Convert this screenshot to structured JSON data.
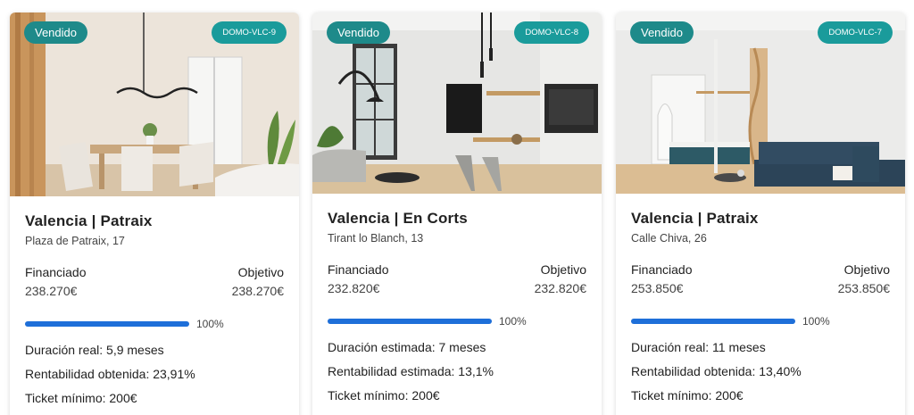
{
  "cards": [
    {
      "sold_label": "Vendido",
      "ref": "DOMO-VLC-9",
      "city": "Valencia | Patraix",
      "street": "Plaza de Patraix, 17",
      "financed_label": "Financiado",
      "financed_value": "238.270€",
      "target_label": "Objetivo",
      "target_value": "238.270€",
      "progress": 1.0,
      "progress_text": "100%",
      "duration": "Duración real: 5,9 meses",
      "returns": "Rentabilidad obtenida: 23,91%",
      "ticket": "Ticket mínimo: 200€"
    },
    {
      "sold_label": "Vendido",
      "ref": "DOMO-VLC-8",
      "city": "Valencia | En Corts",
      "street": "Tirant lo Blanch, 13",
      "financed_label": "Financiado",
      "financed_value": "232.820€",
      "target_label": "Objetivo",
      "target_value": "232.820€",
      "progress": 1.0,
      "progress_text": "100%",
      "duration": "Duración estimada: 7 meses",
      "returns": "Rentabilidad estimada: 13,1%",
      "ticket": "Ticket mínimo: 200€"
    },
    {
      "sold_label": "Vendido",
      "ref": "DOMO-VLC-7",
      "city": "Valencia | Patraix",
      "street": "Calle Chiva, 26",
      "financed_label": "Financiado",
      "financed_value": "253.850€",
      "target_label": "Objetivo",
      "target_value": "253.850€",
      "progress": 1.0,
      "progress_text": "100%",
      "duration": "Duración real: 11 meses",
      "returns": "Rentabilidad obtenida: 13,40%",
      "ticket": "Ticket mínimo: 200€"
    }
  ],
  "colors": {
    "badge_sold": "#1e8a8a",
    "badge_ref": "#1a9b9b",
    "progress": "#1e6fd9"
  }
}
